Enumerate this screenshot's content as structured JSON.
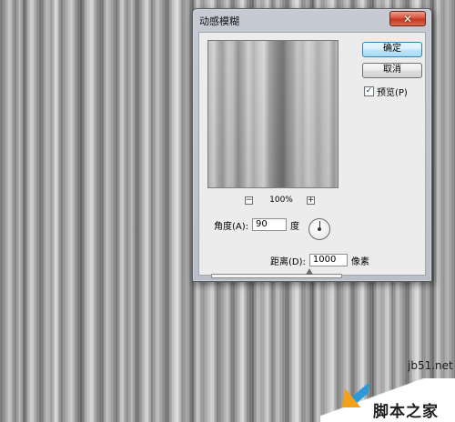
{
  "dialog": {
    "title": "动感模糊",
    "close_glyph": "✕"
  },
  "preview": {
    "zoom_level": "100%",
    "zoom_out_glyph": "−",
    "zoom_in_glyph": "+"
  },
  "buttons": {
    "ok_label": "确定",
    "cancel_label": "取消"
  },
  "preview_checkbox": {
    "label": "预览(P)",
    "checked": true,
    "check_glyph": "✓"
  },
  "angle": {
    "label": "角度(A):",
    "value": "90",
    "unit": "度"
  },
  "distance": {
    "label": "距离(D):",
    "value": "1000",
    "unit": "像素",
    "slider_fraction": 0.75
  },
  "watermark": {
    "site": "jb51.net",
    "brand": "脚本之家"
  },
  "icons": {
    "close": "close-icon",
    "zoom_out": "zoom-out-icon",
    "zoom_in": "zoom-in-icon",
    "check": "check-icon",
    "angle_dial": "angle-dial-icon",
    "logo": "logo-icon"
  },
  "colors": {
    "close_button": "#d8553c",
    "default_button_border": "#3c7fb1",
    "dialog_frame": "#c6cad2"
  }
}
